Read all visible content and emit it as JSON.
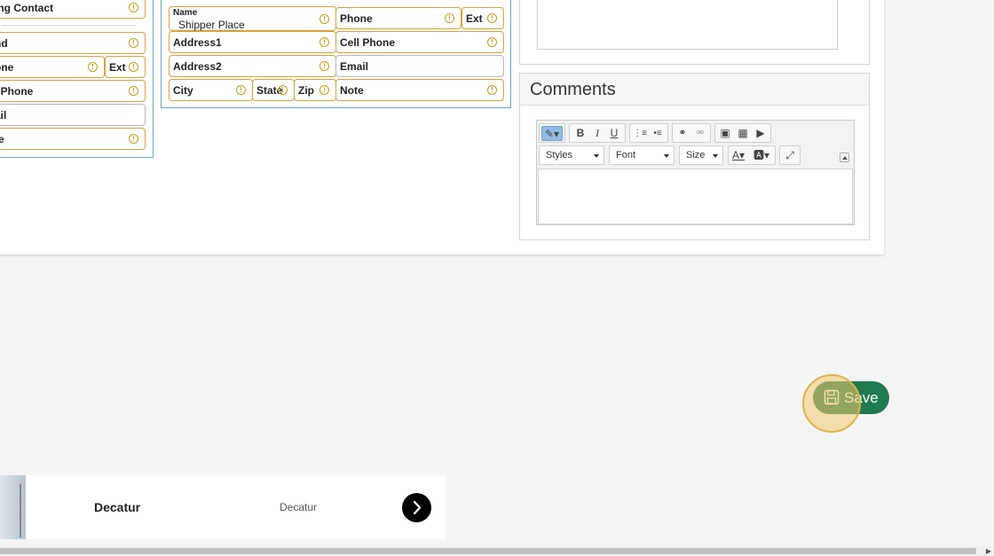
{
  "left_form": {
    "fields": [
      {
        "label": "ing Contact",
        "warn": true
      },
      {
        "label": "nd",
        "warn": true
      },
      {
        "label": "one",
        "warn": true
      },
      {
        "label": "Ext",
        "warn": true
      },
      {
        "label": "l Phone",
        "warn": true
      },
      {
        "label": "ail",
        "warn": false
      },
      {
        "label": "te",
        "warn": true
      }
    ]
  },
  "shipper_form": {
    "name_label": "Name",
    "name_value": "Shipper Place",
    "phone_label": "Phone",
    "ext_label": "Ext",
    "address1_label": "Address1",
    "cell_phone_label": "Cell Phone",
    "address2_label": "Address2",
    "email_label": "Email",
    "city_label": "City",
    "state_label": "State",
    "zip_label": "Zip",
    "note_label": "Note"
  },
  "comments": {
    "title": "Comments",
    "toolbar": {
      "styles_label": "Styles",
      "font_label": "Font",
      "size_label": "Size",
      "buttons": [
        "source",
        "bold",
        "italic",
        "underline",
        "numbered-list",
        "bulleted-list",
        "link",
        "unlink",
        "image",
        "table",
        "video",
        "text-color",
        "background-color",
        "maximize"
      ]
    }
  },
  "save_button": {
    "label": "Save"
  },
  "list_row": {
    "city_primary": "Decatur",
    "city_secondary": "Decatur"
  },
  "colors": {
    "field_warning_border": "#d9a13b",
    "fieldset_border": "#6ba3c4",
    "save_green": "#1f7a4f"
  }
}
